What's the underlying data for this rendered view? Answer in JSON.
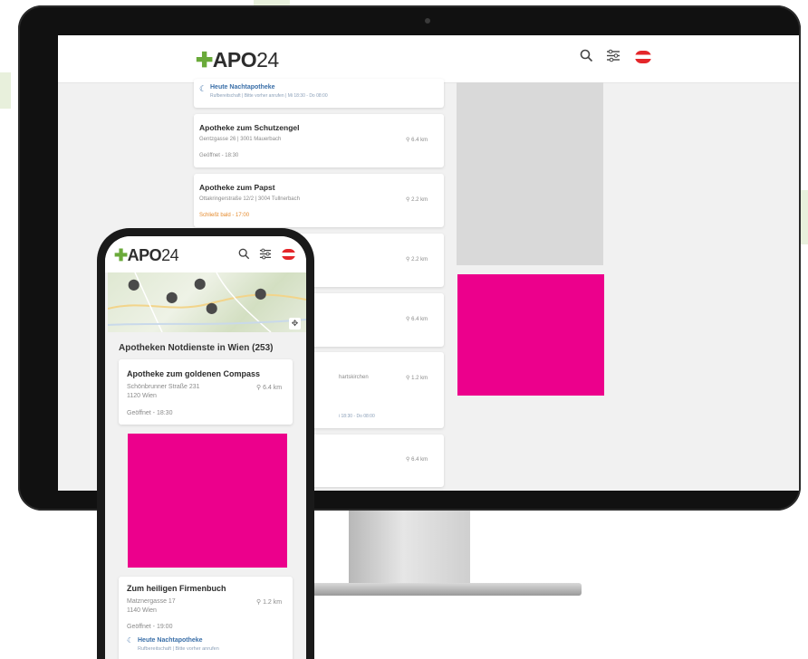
{
  "colors": {
    "accent_green": "#6aaa3a",
    "ad_magenta": "#ec008c",
    "warning_orange": "#e58a2c",
    "night_blue": "#3a6fa8"
  },
  "desktop": {
    "logo_plus": "✚",
    "logo_text": "APO",
    "logo_num": "24",
    "night_banner": {
      "title": "Heute Nachtapotheke",
      "sub": "Rufbereitschaft | Bitte vorher anrufen | Mi 18:30 - Do 08:00"
    },
    "cards": [
      {
        "name": "Apotheke zum Schutzengel",
        "address": "Gentzgasse 26 | 3001 Mauerbach",
        "distance": "6.4 km",
        "status": "Geöffnet - 18:30"
      },
      {
        "name": "Apotheke zum Papst",
        "address": "Ottakringerstraße 12/2 | 3004 Tullnerbach",
        "distance": "2.2 km",
        "status": "Schließt bald - 17:00"
      },
      {
        "distance": "2.2 km"
      },
      {
        "distance": "6.4 km"
      },
      {
        "address": "hartskirchen",
        "distance": "1.2 km",
        "night_sub": "i 18:30 - Do 08:00"
      },
      {
        "distance": "6.4 km"
      }
    ]
  },
  "phone": {
    "logo_plus": "✚",
    "logo_text": "APO",
    "logo_num": "24",
    "section_title": "Apotheken Notdienste in Wien (253)",
    "card1": {
      "name": "Apotheke zum goldenen Compass",
      "address1": "Schönbrunner Straße 231",
      "address2": "1120 Wien",
      "distance": "6.4 km",
      "status": "Geöffnet - 18:30"
    },
    "card2": {
      "name": "Zum heiligen Firmenbuch",
      "address1": "Matznergasse 17",
      "address2": "1140 Wien",
      "distance": "1.2 km",
      "status": "Geöffnet - 19:00",
      "night_title": "Heute Nachtapotheke",
      "night_sub": "Rufbereitschaft | Bitte vorher anrufen"
    }
  },
  "icons": {
    "search": "search-icon",
    "filter": "filter-icon",
    "flag": "austria-flag-icon",
    "pin": "map-pin-icon",
    "moon": "moon-icon",
    "location": "location-icon"
  }
}
